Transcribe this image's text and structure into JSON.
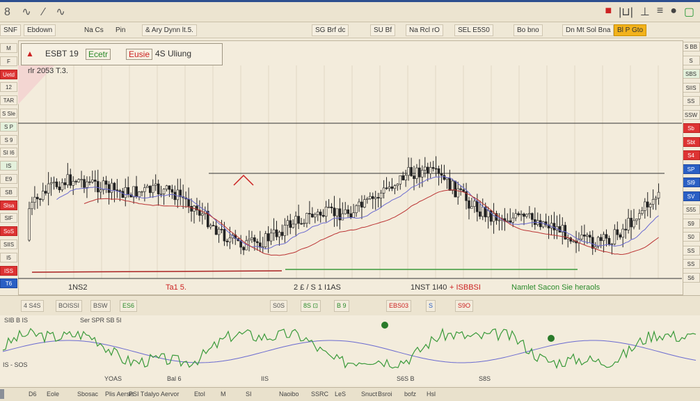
{
  "titlebar": {
    "icons": "8 ∿ ⁄ ∿",
    "right_icons": [
      "■",
      "|⊔|",
      "⊥",
      "≡",
      "●",
      "▢"
    ]
  },
  "toolbar": {
    "items": [
      "SNF",
      "Ebdown",
      "Na Cs",
      "Pin",
      "& Ary Dynn lt.5.",
      "SG Brf dc",
      "SU Bf",
      "Na Rcl rO",
      "SEL E5S0",
      "Bo bno",
      "Dn Mt Sol Bna",
      "Bl P Gto"
    ]
  },
  "info_box": {
    "warn": "▲",
    "a": "ESBT 19",
    "b": "Ecetr",
    "c": "Eusie",
    "d": "4S Uliung"
  },
  "price_label": "rlr 2053 T.3.",
  "axis_labels": [
    {
      "text": "1NS2",
      "cls": ""
    },
    {
      "text": "Ta1 5.",
      "cls": "red"
    },
    {
      "text": "2 £ / S  1 I1AS",
      "cls": ""
    },
    {
      "text": "1NST 1I40",
      "cls": ""
    },
    {
      "text": "+ ISBBSI",
      "cls": "red"
    },
    {
      "text": "Namlet Sacon Sie heraols",
      "cls": "green"
    }
  ],
  "left_panel": [
    {
      "text": "M",
      "cls": ""
    },
    {
      "text": "F",
      "cls": ""
    },
    {
      "text": "Uetd",
      "cls": "red"
    },
    {
      "text": "12",
      "cls": ""
    },
    {
      "text": "TAR",
      "cls": ""
    },
    {
      "text": "S Sle",
      "cls": ""
    },
    {
      "text": "S P",
      "cls": "green"
    },
    {
      "text": "S 9",
      "cls": ""
    },
    {
      "text": "SI I6",
      "cls": ""
    },
    {
      "text": "IS",
      "cls": "green"
    },
    {
      "text": "E9",
      "cls": ""
    },
    {
      "text": "SB",
      "cls": ""
    },
    {
      "text": "Slsa",
      "cls": "red"
    },
    {
      "text": "SlF",
      "cls": ""
    },
    {
      "text": "SoS",
      "cls": "red"
    },
    {
      "text": "SIIS",
      "cls": ""
    },
    {
      "text": "I5",
      "cls": ""
    },
    {
      "text": "ISS",
      "cls": "red"
    },
    {
      "text": "T6",
      "cls": "blue"
    }
  ],
  "right_panel": [
    {
      "text": "S BB",
      "cls": ""
    },
    {
      "text": "S",
      "cls": ""
    },
    {
      "text": "SBS",
      "cls": "green"
    },
    {
      "text": "SIIS",
      "cls": ""
    },
    {
      "text": "SS",
      "cls": ""
    },
    {
      "text": "SSW",
      "cls": ""
    },
    {
      "text": "Sb",
      "cls": "red"
    },
    {
      "text": "Sbt",
      "cls": "red"
    },
    {
      "text": "S4",
      "cls": "red"
    },
    {
      "text": "SP",
      "cls": "blue"
    },
    {
      "text": "Sl9",
      "cls": "blue"
    },
    {
      "text": "SV",
      "cls": "blue"
    },
    {
      "text": "S55",
      "cls": ""
    },
    {
      "text": "S9",
      "cls": ""
    },
    {
      "text": "S0",
      "cls": ""
    },
    {
      "text": "SS",
      "cls": ""
    },
    {
      "text": "SS",
      "cls": ""
    },
    {
      "text": "S6",
      "cls": ""
    }
  ],
  "indicator_bar": [
    {
      "text": "4 S4S",
      "cls": ""
    },
    {
      "text": "BOISSI",
      "cls": ""
    },
    {
      "text": "BSW",
      "cls": ""
    },
    {
      "text": "ES6",
      "cls": "green"
    },
    {
      "text": "S0S",
      "cls": ""
    },
    {
      "text": "8S ⊡",
      "cls": "green"
    },
    {
      "text": "B 9",
      "cls": "green"
    },
    {
      "text": "EBS03",
      "cls": "red"
    },
    {
      "text": "S",
      "cls": "blue"
    },
    {
      "text": "S9O",
      "cls": "red"
    }
  ],
  "sub_labels": {
    "tl": "SIB B IS",
    "mid": "Ser SPR SB 5I",
    "bl": "IS - SOS",
    "x1": "YOAS",
    "x2": "Bal 6",
    "x3": "IIS",
    "x4": "S6S B",
    "x5": "S8S"
  },
  "bottombar": [
    "D6",
    "Eole",
    "Sbosac",
    "Plis Aersis",
    "PSI Tdalyo Aervor",
    "EtoI",
    "M",
    "SI",
    "Naoibo",
    "SSRC",
    "LeS",
    "Snuct",
    "Bsroi",
    "bofz",
    "Hsl"
  ],
  "colors": {
    "bg": "#f3ecdc",
    "accent": "#2d4f8f",
    "up": "#2a9a3a",
    "down": "#cc2222",
    "ma": "#6a6ad0"
  }
}
